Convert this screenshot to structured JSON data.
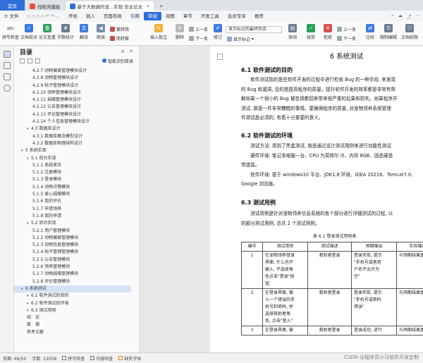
{
  "tabs": {
    "home": "首页",
    "t1": "找稻壳模板",
    "t2": "基于大数据的宠...实现 毕业论文"
  },
  "menu": {
    "file": "文件",
    "items": [
      "开始",
      "插入",
      "页面布局",
      "引用",
      "审阅",
      "视图",
      "章节",
      "开发工具",
      "会员专享",
      "推荐"
    ],
    "selected": "审阅"
  },
  "ribbon": {
    "spell": "拼写检查",
    "docproof": "文档校对",
    "dup": "论文查重",
    "count": "字数统计",
    "translate": "翻译",
    "read": "朗读",
    "trad": "繁转简",
    "simp": "简转繁",
    "comment": "插入批注",
    "del": "删除",
    "prev": "上一条",
    "next": "下一条",
    "track": "修订",
    "select_box": "显示标记的最终状态",
    "show_markup": "显示标记",
    "reviewing": "审阅",
    "accept": "接受",
    "reject": "拒绝",
    "prev2": "上一条",
    "next2": "下一条",
    "compare": "比较",
    "restrict": "限制编辑",
    "protect": "文档权限",
    "limit_edit": "限制编辑",
    "doc_auth": "文档认证"
  },
  "toc": {
    "title": "目录",
    "smart": "智能识别目录",
    "items": [
      {
        "level": 3,
        "text": "4.2.7 动物偏爱管理模块设计",
        "hl": false
      },
      {
        "level": 3,
        "text": "4.2.8 动物管理模块设计",
        "hl": false
      },
      {
        "level": 3,
        "text": "4.2.9 帖子管理模块设计",
        "hl": false
      },
      {
        "level": 3,
        "text": "4.2.10 领养管理模块设计",
        "hl": false
      },
      {
        "level": 3,
        "text": "4.2.11 捐赠管理模块设计",
        "hl": false
      },
      {
        "level": 3,
        "text": "4.2.12 公告管理模块设计",
        "hl": false
      },
      {
        "level": 3,
        "text": "4.2.13 评论管理模块设计",
        "hl": false
      },
      {
        "level": 3,
        "text": "4.2.14 个人信息管理模块设计",
        "hl": false
      },
      {
        "level": 2,
        "text": "4.3 数据库设计",
        "hl": false
      },
      {
        "level": 3,
        "text": "4.3.1 数据库概念模型设计",
        "hl": false
      },
      {
        "level": 3,
        "text": "4.3.2 数据库物理结构设计",
        "hl": false
      },
      {
        "level": 1,
        "text": "5 系统实现",
        "hl": false
      },
      {
        "level": 2,
        "text": "5.1 前台实现",
        "hl": false
      },
      {
        "level": 3,
        "text": "5.1.1 系统首页",
        "hl": false
      },
      {
        "level": 3,
        "text": "5.1.2 注册模块",
        "hl": false
      },
      {
        "level": 3,
        "text": "5.1.3 登录模块",
        "hl": false
      },
      {
        "level": 3,
        "text": "5.1.4 动物详情模块",
        "hl": false
      },
      {
        "level": 3,
        "text": "5.1.5 爱心捐赠模块",
        "hl": false
      },
      {
        "level": 3,
        "text": "5.1.6 我的评价",
        "hl": false
      },
      {
        "level": 3,
        "text": "5.1.7 申请领养",
        "hl": false
      },
      {
        "level": 3,
        "text": "5.1.8 我的申请",
        "hl": false
      },
      {
        "level": 2,
        "text": "5.2 后台实现",
        "hl": false
      },
      {
        "level": 3,
        "text": "5.2.1 用户管理模块",
        "hl": false
      },
      {
        "level": 3,
        "text": "5.2.2 动物偏爱管理模块",
        "hl": false
      },
      {
        "level": 3,
        "text": "5.2.3 动物信息管理模块",
        "hl": false
      },
      {
        "level": 3,
        "text": "5.2.4 帖子管理管理模块",
        "hl": false
      },
      {
        "level": 3,
        "text": "5.2.5 公告管理模块",
        "hl": false
      },
      {
        "level": 3,
        "text": "5.2.6 领养管理模块",
        "hl": false
      },
      {
        "level": 3,
        "text": "5.2.7 动物捐赠管理模块",
        "hl": false
      },
      {
        "level": 3,
        "text": "5.2.8 评价管理模块",
        "hl": false
      },
      {
        "level": 1,
        "text": "6 系统测试",
        "hl": true
      },
      {
        "level": 2,
        "text": "6.1 软件测试的目的",
        "hl": false
      },
      {
        "level": 2,
        "text": "6.2 软件测试的环境",
        "hl": false
      },
      {
        "level": 2,
        "text": "6.3 测试用例",
        "hl": false
      },
      {
        "level": 0,
        "text": "结　论",
        "hl": false
      },
      {
        "level": 0,
        "text": "致　谢",
        "hl": false
      },
      {
        "level": 0,
        "text": "参考文献",
        "hl": false
      }
    ]
  },
  "doc": {
    "h1": "6  系统测试",
    "s61": "6.1  软件测试的目的",
    "p61": [
      "　　软件测试指的是在软件开发的过程中进行检索 Bug 的一种手段, 来发现",
      "的 Bug 和漏洞, 目的是提高程序的质量。提升软件开发的效率都是非常有帮",
      "解如果一个很小的 Bug 被忽视都回来带来很严重的后果和损失。如果程序开",
      "测试, 那是一件非常糟糕的事情。要确保程序的质量, 对宠物领养系统管理",
      "件测试是必须的, 有着十分重要的意义。"
    ],
    "s62": "6.2  软件测试的环境",
    "p62": [
      "　　测试方法: 用到了黑盒测试, 就是通过设计测试用例来进行功能性测试",
      "　　硬件环境: 笔记本电脑一台、CPU 为英特尔 i5、内存 8GB、固态硬盘",
      "带连接。",
      "　　软件环境: 基于 windows10 平台、JDK1.8 环境、IDEA 20218、Tomcat7.0、",
      "Google 浏览器。"
    ],
    "s63": "6.3  测试用例",
    "p63": [
      "　　测试用例是针对宠物领养信息系统的各个部分进行详细测试的过程, 以",
      "的部分测试用例, 总共 2 个测试用例。"
    ],
    "caption": "表 6.1  登录测试用例表",
    "table": {
      "headers": [
        "编号",
        "测试用例",
        "测试描述",
        "预期输出",
        "实际输出"
      ],
      "rows": [
        {
          "id": "1",
          "case": [
            "在宠物领养登录",
            "界面, 什么也不",
            "输入, 不选择角",
            "色点击\"登录\"按",
            "钮"
          ],
          "desc": [
            "救助者登录"
          ],
          "exp": [
            "登录失败, 提示",
            "\"手机号或者用",
            "户名不允许为",
            "空\""
          ],
          "act": [
            "与预期结果基本"
          ]
        },
        {
          "id": "2",
          "case": [
            "在登录界面, 输",
            "入一个错误的手",
            "机号和密码, 并",
            "选择救助者角",
            "色, 点击\"登入\""
          ],
          "desc": [
            "救助者登录"
          ],
          "exp": [
            "登录失败, 提示",
            "\"手机号或密码",
            "错误\""
          ],
          "act": [
            "与预期结果基本"
          ]
        },
        {
          "id": "3",
          "case": [
            "在登录界面, 输"
          ],
          "desc": [
            "救助者登录"
          ],
          "exp": [
            "登录成功, 进行"
          ],
          "act": [
            "与预期结果基本"
          ]
        }
      ]
    }
  },
  "status": {
    "page": "页面: 46/50",
    "words": "字数: 12058",
    "spell": "拼写检查",
    "content": "内容检查",
    "font": "缺失字体"
  },
  "watermark": "CSDN @程序员小马软件开发定制",
  "colors": {
    "accent": "#2f6fd9",
    "tabbar": "#dfe3e8",
    "highlight": "#d6e3f7"
  }
}
